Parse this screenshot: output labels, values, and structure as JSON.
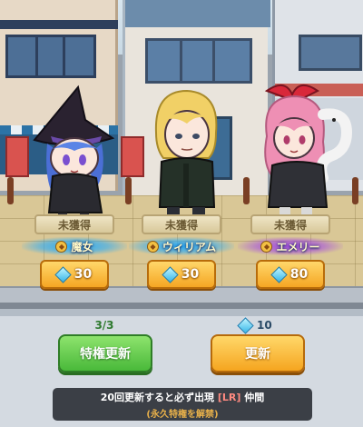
{
  "cards": [
    {
      "status": "未獲得",
      "name": "魔女",
      "price": "30",
      "glow": "blue"
    },
    {
      "status": "未獲得",
      "name": "ウィリアム",
      "price": "30",
      "glow": "blue"
    },
    {
      "status": "未獲得",
      "name": "エメリー",
      "price": "80",
      "glow": "purple"
    }
  ],
  "refresh": {
    "privilege_count": "3/3",
    "privilege_label": "特権更新",
    "cost": "10",
    "label": "更新"
  },
  "info": {
    "line1_before": "20回更新すると必ず出現",
    "line1_tag": "[LR]",
    "line1_after": "仲間",
    "line2": "(永久特権を解禁)"
  },
  "colors": {
    "glow_blue": "#1eaaff",
    "glow_purple": "#a046e6",
    "button_green": "#49b93a",
    "button_orange": "#f5a51f"
  },
  "icons": [
    "gem-icon",
    "rarity-medal-icon"
  ]
}
